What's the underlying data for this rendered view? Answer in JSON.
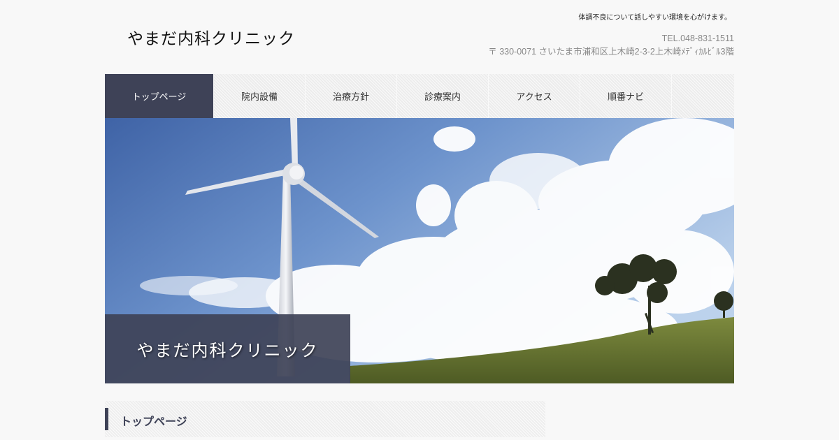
{
  "header": {
    "tagline": "体調不良について話しやすい環境を心がけます。",
    "site_title": "やまだ内科クリニック",
    "tel": "TEL.048-831-1511",
    "address": "〒 330-0071 さいたま市浦和区上木崎2-3-2上木崎ﾒﾃﾞｨｶﾙﾋﾞﾙ3階"
  },
  "nav": {
    "items": [
      {
        "label": "トップページ",
        "active": true
      },
      {
        "label": "院内設備"
      },
      {
        "label": "治療方針"
      },
      {
        "label": "診療案内"
      },
      {
        "label": "アクセス"
      },
      {
        "label": "順番ナビ"
      }
    ]
  },
  "hero": {
    "caption": "やまだ内科クリニック"
  },
  "main": {
    "section_title": "トップページ"
  },
  "colors": {
    "accent": "#3e4257",
    "background": "#f8f8f8"
  }
}
